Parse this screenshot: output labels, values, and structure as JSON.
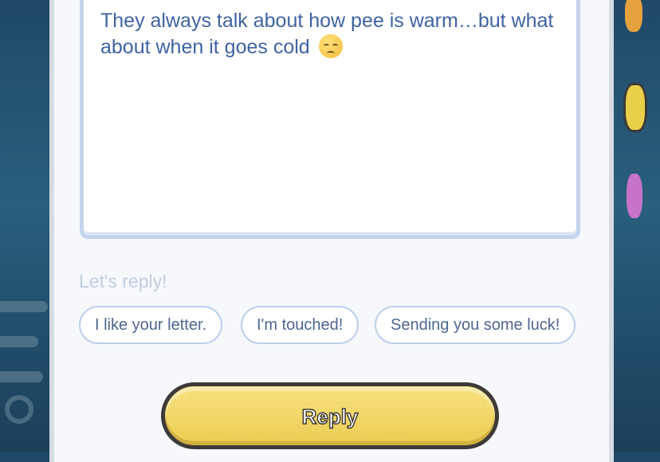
{
  "letter": {
    "text": "They always talk about how pee is warm…but what about when it goes cold",
    "emoji": "pensive-face"
  },
  "reply_prompt": "Let's reply!",
  "quick_replies": [
    {
      "label": "I like your letter."
    },
    {
      "label": "I'm touched!"
    },
    {
      "label": "Sending you some luck!"
    }
  ],
  "reply_button": {
    "label": "Reply"
  },
  "colors": {
    "background": "#22506e",
    "panel": "#f6f8fc",
    "letter_text": "#3f63a3",
    "button_fill": "#f1d564",
    "chip_border": "#bcd0e9"
  }
}
